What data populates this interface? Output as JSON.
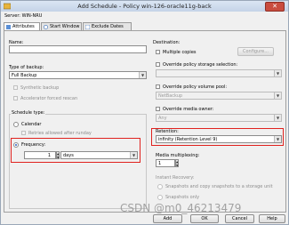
{
  "window": {
    "title": "Add Schedule - Policy win-126-oracle11g-back",
    "close": "✕"
  },
  "server": "Server: WIN-NRU",
  "tabs": [
    {
      "label": "Attributes"
    },
    {
      "label": "Start Window"
    },
    {
      "label": "Exclude Dates"
    }
  ],
  "left": {
    "name_label": "Name:",
    "name_value": "",
    "type_label": "Type of backup:",
    "type_value": "Full Backup",
    "synthetic": "Synthetic backup",
    "accelerator": "Accelerator forced rescan",
    "schedule_type_label": "Schedule type:",
    "calendar": "Calendar",
    "retries": "Retries allowed after runday",
    "frequency": "Frequency:",
    "frequency_value": "1",
    "frequency_unit": "days"
  },
  "right": {
    "destination_label": "Destination:",
    "multiple_copies": "Multiple copies",
    "configure": "Configure...",
    "override_storage": "Override policy storage selection:",
    "override_volume": "Override policy volume pool:",
    "volume_value": "NetBackup",
    "override_media_owner": "Override media owner:",
    "media_owner_value": "Any",
    "retention_label": "Retention:",
    "retention_value": "infinity (Retention Level 9)",
    "multiplexing_label": "Media multiplexing:",
    "multiplexing_value": "1",
    "instant_recovery": "Instant Recovery:",
    "snap_copy": "Snapshots and copy snapshots to a storage unit",
    "snap_only": "Snapshots only"
  },
  "buttons": {
    "add": "Add",
    "ok": "OK",
    "cancel": "Cancel",
    "help": "Help"
  },
  "watermark": "CSDN @m0_46213479",
  "colors": {
    "highlight": "#e0221f",
    "title_bg": "#c4d3e8"
  }
}
